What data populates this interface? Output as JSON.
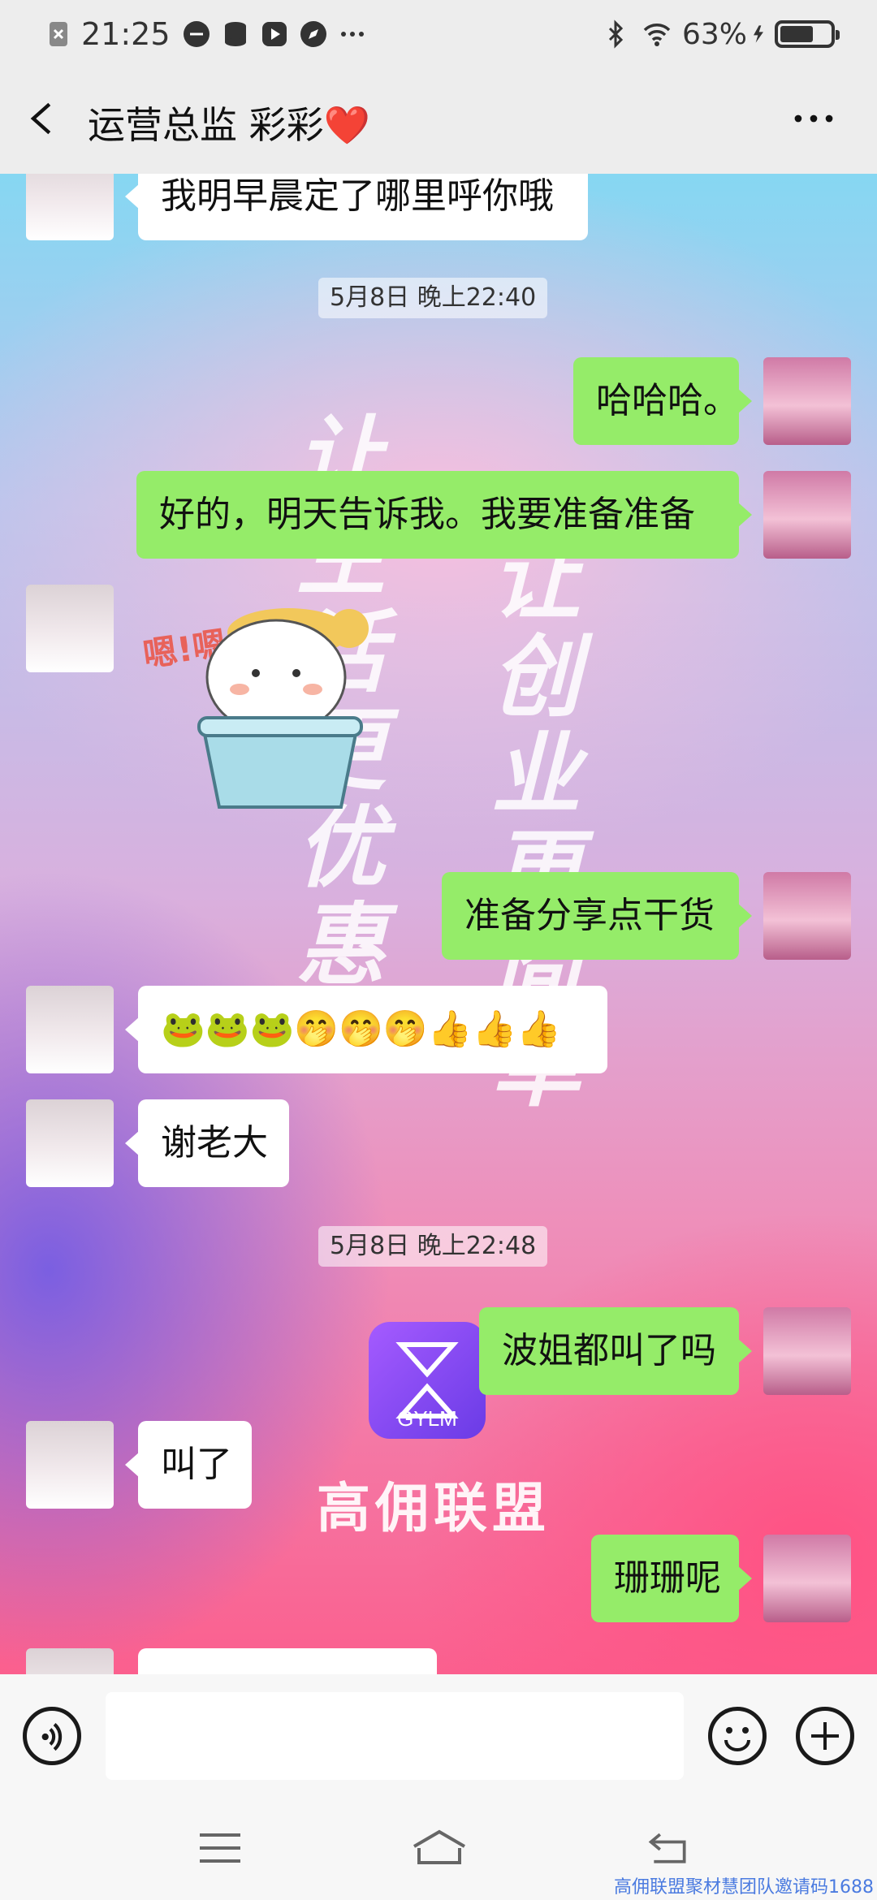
{
  "status_bar": {
    "time": "21:25",
    "battery": "63%",
    "left_icons": [
      "notification-x-icon",
      "data-icon",
      "storage-icon",
      "media-icon",
      "compass-icon",
      "more-dots-icon"
    ],
    "right_icons": [
      "bluetooth-icon",
      "wifi-icon",
      "charging-icon",
      "battery-icon"
    ],
    "battery_level": 0.63
  },
  "header": {
    "title": "运营总监 彩彩❤️",
    "back_icon": "back-arrow-icon",
    "menu_icon": "more-dots-icon"
  },
  "watermark": {
    "left_text": "让生活更优惠",
    "right_text": "让创业更简单",
    "brand_logo_text": "GYLM",
    "brand_name": "高佣联盟"
  },
  "messages": [
    {
      "side": "left",
      "type": "text",
      "text": "我明早晨定了哪里呼你哦"
    },
    {
      "type": "timestamp",
      "text": "5月8日 晚上22:40"
    },
    {
      "side": "right",
      "type": "text",
      "text": "哈哈哈。"
    },
    {
      "side": "right",
      "type": "text",
      "text": "好的，明天告诉我。我要准备准备"
    },
    {
      "side": "left",
      "type": "sticker",
      "text": "嗯!嗯!嗯!"
    },
    {
      "side": "right",
      "type": "text",
      "text": "准备分享点干货"
    },
    {
      "side": "left",
      "type": "text",
      "text": "🐸🐸🐸🤭🤭🤭👍👍👍"
    },
    {
      "side": "left",
      "type": "text",
      "text": "谢老大"
    },
    {
      "type": "timestamp",
      "text": "5月8日 晚上22:48"
    },
    {
      "side": "right",
      "type": "text",
      "text": "波姐都叫了吗"
    },
    {
      "side": "left",
      "type": "text",
      "text": "叫了"
    },
    {
      "side": "right",
      "type": "text",
      "text": "珊珊呢"
    },
    {
      "side": "left",
      "type": "text",
      "text": ""
    }
  ],
  "input_bar": {
    "voice_icon": "voice-icon",
    "emoji_icon": "emoji-icon",
    "plus_icon": "plus-icon",
    "text_value": ""
  },
  "nav_bar": {
    "icons": [
      "menu-icon",
      "home-icon",
      "back-icon"
    ]
  },
  "corner_watermark": "高佣联盟聚材慧团队邀请码1688"
}
